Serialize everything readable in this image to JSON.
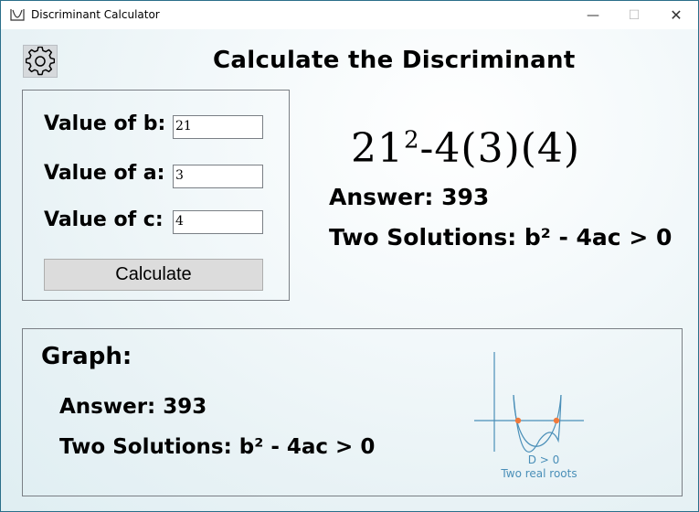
{
  "window": {
    "title": "Discriminant Calculator",
    "minimize": "—",
    "maximize": "☐",
    "close": "✕"
  },
  "settings": {
    "icon": "gear-icon"
  },
  "heading": "Calculate the Discriminant",
  "inputs": {
    "b_label": "Value of b:",
    "b_value": "21",
    "a_label": "Value of a:",
    "a_value": "3",
    "c_label": "Value of c:",
    "c_value": "4",
    "calculate_label": "Calculate"
  },
  "result": {
    "formula_base": "21",
    "formula_exp": "2",
    "formula_rest": "-4(3)(4)",
    "answer": "Answer: 393",
    "solutions": "Two Solutions: b² - 4ac > 0"
  },
  "graph": {
    "title": "Graph:",
    "answer": "Answer: 393",
    "solutions": "Two Solutions: b² - 4ac > 0",
    "caption_condition": "D > 0",
    "caption_roots": "Two real roots"
  },
  "colors": {
    "root_marker": "#f07a3c",
    "axis": "#4a8fb8",
    "caption": "#4a8fb8"
  }
}
